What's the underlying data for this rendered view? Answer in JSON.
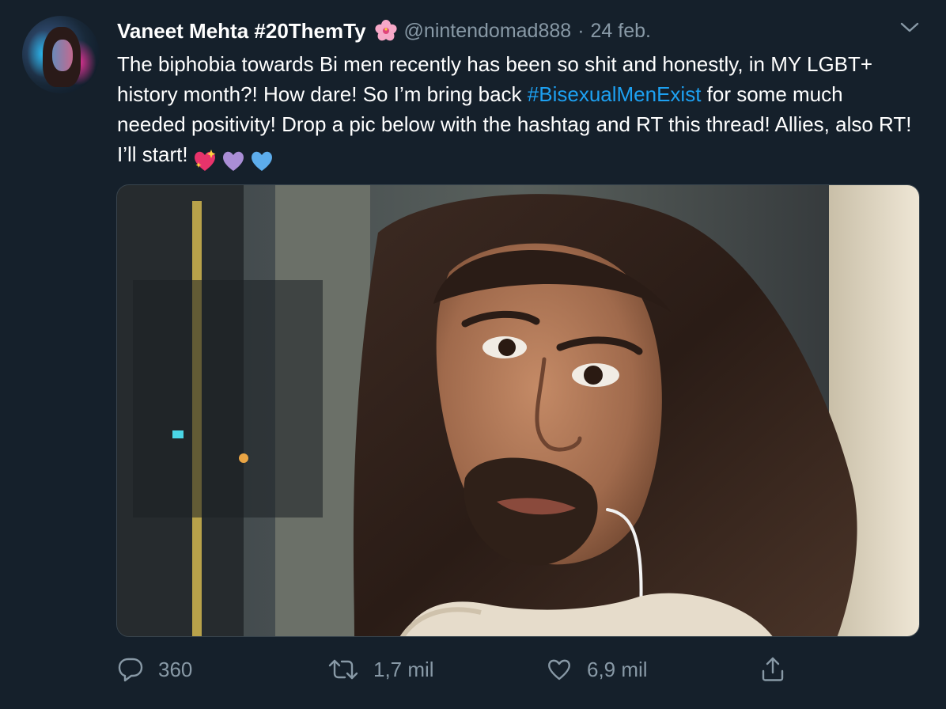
{
  "author": {
    "display_name": "Vaneet Mehta #20ThemTy",
    "name_emoji": "hibiscus-emoji",
    "handle": "@nintendomad888",
    "separator": "·",
    "date": "24 feb."
  },
  "tweet": {
    "text_before_hashtag": "The biphobia towards Bi men recently has been so shit and honestly, in MY LGBT+ history month?! How dare! So I’m bring back ",
    "hashtag": "#BisexualMenExist",
    "text_after_hashtag": " for some much needed positivity! Drop a pic below with the hashtag and RT this thread! Allies, also RT! I’ll start!",
    "emojis": [
      "sparkling-heart-emoji",
      "purple-heart-emoji",
      "blue-heart-emoji"
    ],
    "hashtag_color": "#1da1f2"
  },
  "media": {
    "icon": "photo-selfie"
  },
  "actions": {
    "reply": {
      "icon": "reply-icon",
      "count": "360"
    },
    "retweet": {
      "icon": "retweet-icon",
      "count": "1,7 mil"
    },
    "like": {
      "icon": "heart-icon",
      "count": "6,9 mil"
    },
    "share": {
      "icon": "share-icon"
    }
  },
  "colors": {
    "background": "#15202b",
    "secondary_text": "#8899a6",
    "accent": "#1da1f2",
    "border": "#38444d"
  }
}
